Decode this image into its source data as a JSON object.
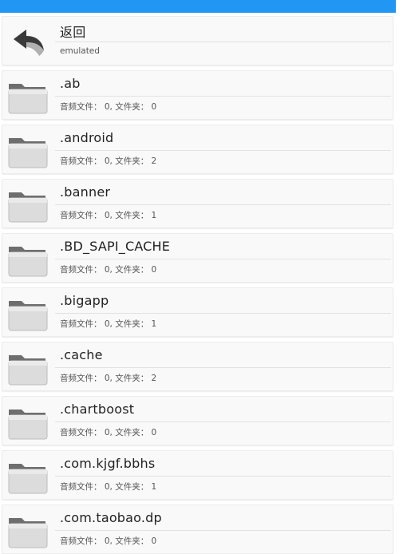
{
  "header": {
    "bar_color": "#2196f3"
  },
  "back_item": {
    "title": "返回",
    "subtitle": "emulated",
    "icon": "back-arrow-icon"
  },
  "folders": [
    {
      "name": ".ab",
      "info": "音频文件： 0, 文件夹： 0"
    },
    {
      "name": ".android",
      "info": "音频文件： 0, 文件夹： 2"
    },
    {
      "name": ".banner",
      "info": "音频文件： 0, 文件夹： 1"
    },
    {
      "name": ".BD_SAPI_CACHE",
      "info": "音频文件： 0, 文件夹： 0"
    },
    {
      "name": ".bigapp",
      "info": "音频文件： 0, 文件夹： 1"
    },
    {
      "name": ".cache",
      "info": "音频文件： 0, 文件夹： 2"
    },
    {
      "name": ".chartboost",
      "info": "音频文件： 0, 文件夹： 0"
    },
    {
      "name": ".com.kjgf.bbhs",
      "info": "音频文件： 0, 文件夹： 1"
    },
    {
      "name": ".com.taobao.dp",
      "info": "音频文件： 0, 文件夹： 0"
    }
  ],
  "folder_icon": "folder-icon"
}
